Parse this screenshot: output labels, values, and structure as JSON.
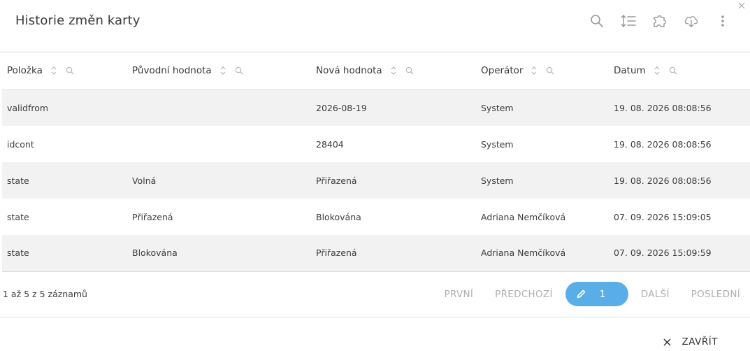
{
  "dialog": {
    "title": "Historie změn karty",
    "toolbar": [
      "search-icon",
      "line-height-icon",
      "puzzle-icon",
      "cloud-download-icon",
      "more-vertical-icon"
    ],
    "close_icon": "close-icon"
  },
  "table": {
    "columns": [
      "Položka",
      "Původní hodnota",
      "Nová hodnota",
      "Operátor",
      "Datum"
    ],
    "rows": [
      [
        "validfrom",
        "",
        "2026-08-19",
        "System",
        "19. 08. 2026 08:08:56"
      ],
      [
        "idcont",
        "",
        "28404",
        "System",
        "19. 08. 2026 08:08:56"
      ],
      [
        "state",
        "Volná",
        "Přiřazená",
        "System",
        "19. 08. 2026 08:08:56"
      ],
      [
        "state",
        "Přiřazená",
        "Blokována",
        "Adriana Nemčíková",
        "07. 09. 2026 15:09:05"
      ],
      [
        "state",
        "Blokována",
        "Přiřazená",
        "Adriana Nemčíková",
        "07. 09. 2026 15:09:59"
      ]
    ]
  },
  "footer": {
    "info": "1 až 5 z 5 záznamů",
    "pager": {
      "first": "PRVNÍ",
      "prev": "PŘEDCHOZÍ",
      "current": "1",
      "next": "DALŠÍ",
      "last": "POSLEDNÍ"
    },
    "close_label": "ZAVŘÍT"
  },
  "colors": {
    "accent": "#5aaee8",
    "row_stripe": "#f2f2f2",
    "border": "#dcdcdc",
    "muted": "#b0b0b0"
  }
}
